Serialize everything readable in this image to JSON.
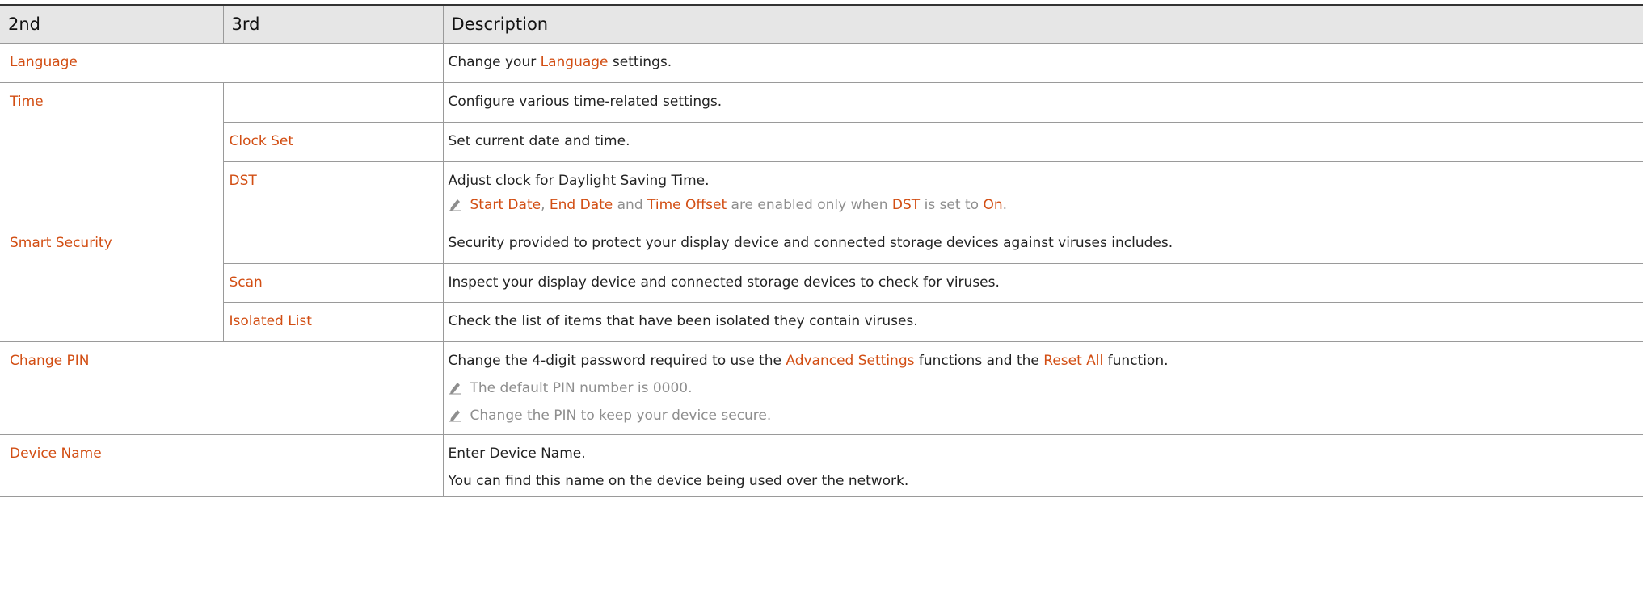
{
  "headers": {
    "col2": "2nd",
    "col3": "3rd",
    "desc": "Description"
  },
  "colors": {
    "accent": "#d24e13",
    "note": "#8e8e8e",
    "header_bg": "#e6e6e6"
  },
  "rows": {
    "language": {
      "label": "Language",
      "desc_before": "Change your ",
      "desc_link": "Language",
      "desc_after": " settings."
    },
    "time": {
      "label": "Time",
      "desc": "Configure various time-related settings."
    },
    "clock_set": {
      "label": "Clock Set",
      "desc": "Set current date and time."
    },
    "dst": {
      "label": "DST",
      "desc": "Adjust clock for Daylight Saving Time.",
      "note": {
        "icon": "pencil-note-icon",
        "start_date": "Start Date",
        "sep1": ", ",
        "end_date": "End Date",
        "and": " and ",
        "time_offset": "Time Offset",
        "middle": " are enabled only when ",
        "dst": "DST",
        "is_set": " is set to ",
        "on": "On",
        "end": "."
      }
    },
    "smart_security": {
      "label": "Smart Security",
      "desc": "Security provided to protect your display device and connected storage devices against viruses includes."
    },
    "scan": {
      "label": "Scan",
      "desc": "Inspect your display device and connected storage devices to check for viruses."
    },
    "isolated_list": {
      "label": "Isolated List",
      "desc": "Check the list of items that have been isolated they contain viruses."
    },
    "change_pin": {
      "label": "Change PIN",
      "desc_before": "Change the 4-digit password required to use the ",
      "advanced": "Advanced Settings",
      "desc_mid": " functions and the ",
      "reset_all": "Reset All",
      "desc_after": " function.",
      "note1": "The default PIN number is 0000.",
      "note2": "Change the PIN to keep your device secure."
    },
    "device_name": {
      "label": "Device Name",
      "desc1": "Enter Device Name.",
      "desc2": "You can find this name on the device being used over the network."
    }
  }
}
